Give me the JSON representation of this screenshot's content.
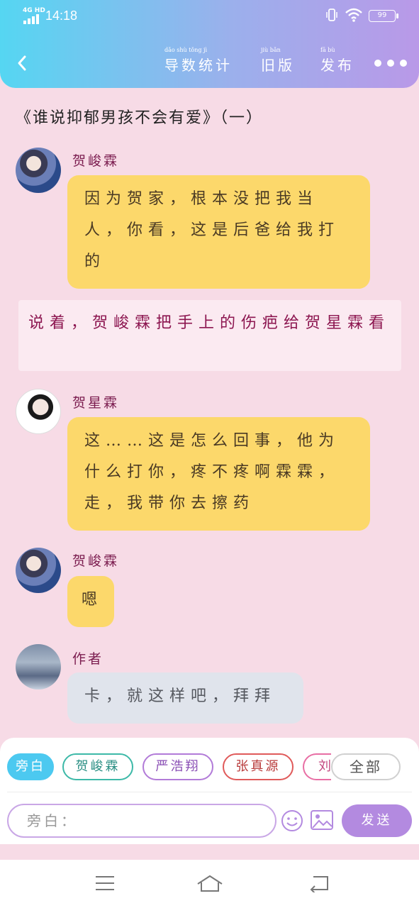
{
  "status_bar": {
    "network": "4G HD",
    "time": "14:18",
    "battery": "99"
  },
  "header": {
    "buttons": [
      {
        "label": "导数统计",
        "pinyin": "dǎo shù tǒng jì"
      },
      {
        "label": "旧版",
        "pinyin": "jiù bǎn"
      },
      {
        "label": "发布",
        "pinyin": "fā bù"
      }
    ]
  },
  "story": {
    "title": "《谁说抑郁男孩不会有爱》（一）"
  },
  "messages": [
    {
      "sender": "贺峻霖",
      "text": "因为贺家，根本没把我当人，你看，这是后爸给我打的",
      "style": "yellow"
    },
    {
      "narration": "说着，贺峻霖把手上的伤疤给贺星霖看"
    },
    {
      "sender": "贺星霖",
      "text": "这……这是怎么回事，他为什么打你，疼不疼啊霖霖，走，我带你去擦药",
      "style": "yellow"
    },
    {
      "sender": "贺峻霖",
      "text": "嗯",
      "style": "yellow"
    },
    {
      "sender": "作者",
      "text": "卡，就这样吧，拜拜",
      "style": "gray"
    }
  ],
  "composer": {
    "roles": [
      "旁白",
      "贺峻霖",
      "严浩翔",
      "张真源",
      "刘"
    ],
    "all_label": "全部",
    "input_placeholder": "旁白：",
    "send_label": "发送"
  },
  "colors": {
    "header_gradient_start": "#55d6f2",
    "header_gradient_end": "#b999e8",
    "background": "#f7dbe6",
    "bubble_yellow": "#fcd86b",
    "bubble_gray": "#e0e4ec",
    "sender_name": "#7a1b4e",
    "narration_text": "#8c1650",
    "send_button": "#b38ae0"
  }
}
